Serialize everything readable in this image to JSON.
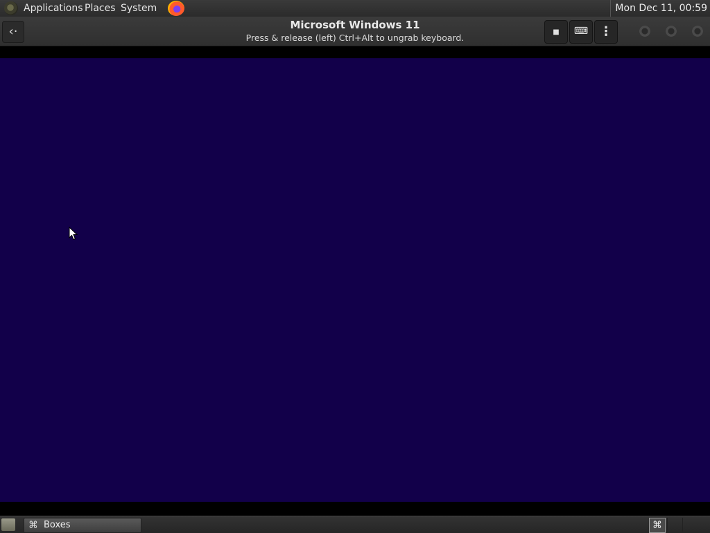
{
  "topbar": {
    "menus": [
      "Applications",
      "Places",
      "System"
    ],
    "clock": "Mon Dec 11, 00:59",
    "launchers": [
      "firefox-icon"
    ]
  },
  "headerbar": {
    "title": "Microsoft Windows 11",
    "subtitle": "Press & release (left) Ctrl+Alt to ungrab keyboard.",
    "back_icon": "‹·",
    "buttons": [
      "stop-icon",
      "keyboard-icon",
      "menu-kebab-icon"
    ],
    "stop_glyph": "■",
    "keyboard_glyph": "⌨",
    "menu_glyph": "⋮"
  },
  "vm": {
    "screen_color": "#12004a"
  },
  "taskbar": {
    "task_label": "Boxes",
    "task_icon": "⌘",
    "workspace_icon": "⌘"
  }
}
